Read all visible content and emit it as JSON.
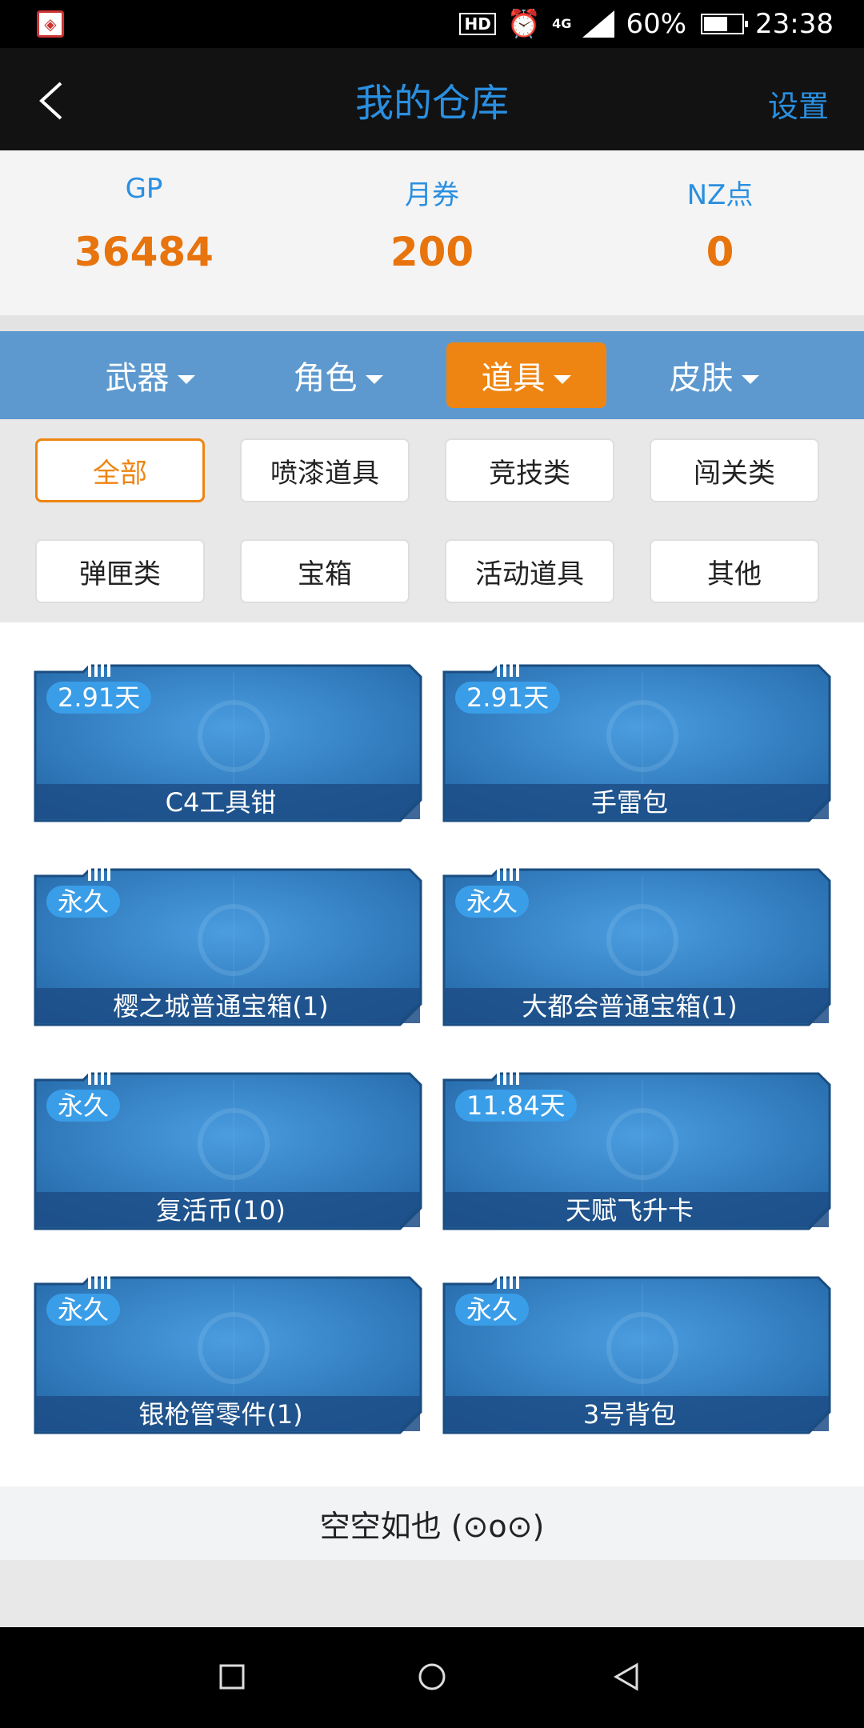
{
  "status_bar": {
    "hd": "HD",
    "network": "4G",
    "battery": "60%",
    "battery_level": 0.6,
    "time": "23:38"
  },
  "header": {
    "title": "我的仓库",
    "settings_label": "设置"
  },
  "currency": [
    {
      "label": "GP",
      "value": "36484"
    },
    {
      "label": "月券",
      "value": "200"
    },
    {
      "label": "NZ点",
      "value": "0"
    }
  ],
  "tabs": [
    {
      "label": "武器",
      "active": false
    },
    {
      "label": "角色",
      "active": false
    },
    {
      "label": "道具",
      "active": true
    },
    {
      "label": "皮肤",
      "active": false
    }
  ],
  "filters": [
    {
      "label": "全部",
      "active": true
    },
    {
      "label": "喷漆道具",
      "active": false
    },
    {
      "label": "竞技类",
      "active": false
    },
    {
      "label": "闯关类",
      "active": false
    },
    {
      "label": "弹匣类",
      "active": false
    },
    {
      "label": "宝箱",
      "active": false
    },
    {
      "label": "活动道具",
      "active": false
    },
    {
      "label": "其他",
      "active": false
    }
  ],
  "items": [
    {
      "duration": "2.91天",
      "name": "C4工具钳"
    },
    {
      "duration": "2.91天",
      "name": "手雷包"
    },
    {
      "duration": "永久",
      "name": "樱之城普通宝箱(1)"
    },
    {
      "duration": "永久",
      "name": "大都会普通宝箱(1)"
    },
    {
      "duration": "永久",
      "name": "复活币(10)"
    },
    {
      "duration": "11.84天",
      "name": "天赋飞升卡"
    },
    {
      "duration": "永久",
      "name": "银枪管零件(1)"
    },
    {
      "duration": "永久",
      "name": "3号背包"
    }
  ],
  "empty_note": "空空如也 (⊙o⊙)",
  "colors": {
    "accent_blue": "#2a8fe0",
    "accent_orange": "#ee8512",
    "tab_bar": "#5d99cf"
  }
}
